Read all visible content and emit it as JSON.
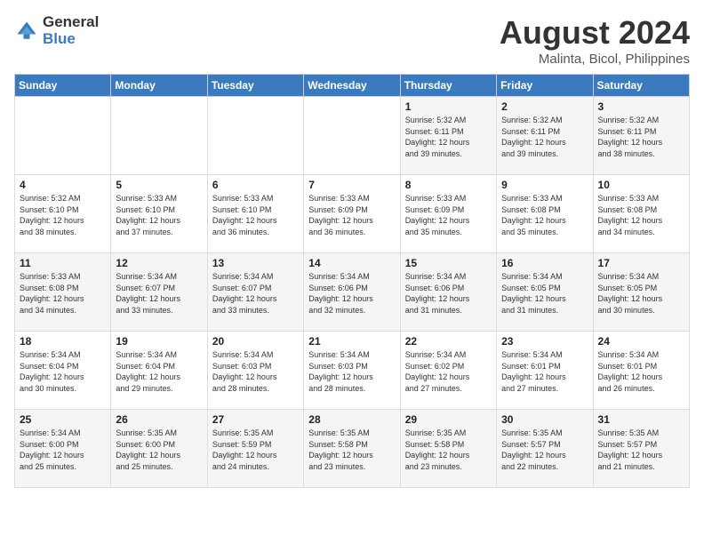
{
  "header": {
    "logo_general": "General",
    "logo_blue": "Blue",
    "month": "August 2024",
    "location": "Malinta, Bicol, Philippines"
  },
  "days_of_week": [
    "Sunday",
    "Monday",
    "Tuesday",
    "Wednesday",
    "Thursday",
    "Friday",
    "Saturday"
  ],
  "weeks": [
    [
      {
        "num": "",
        "detail": ""
      },
      {
        "num": "",
        "detail": ""
      },
      {
        "num": "",
        "detail": ""
      },
      {
        "num": "",
        "detail": ""
      },
      {
        "num": "1",
        "detail": "Sunrise: 5:32 AM\nSunset: 6:11 PM\nDaylight: 12 hours\nand 39 minutes."
      },
      {
        "num": "2",
        "detail": "Sunrise: 5:32 AM\nSunset: 6:11 PM\nDaylight: 12 hours\nand 39 minutes."
      },
      {
        "num": "3",
        "detail": "Sunrise: 5:32 AM\nSunset: 6:11 PM\nDaylight: 12 hours\nand 38 minutes."
      }
    ],
    [
      {
        "num": "4",
        "detail": "Sunrise: 5:32 AM\nSunset: 6:10 PM\nDaylight: 12 hours\nand 38 minutes."
      },
      {
        "num": "5",
        "detail": "Sunrise: 5:33 AM\nSunset: 6:10 PM\nDaylight: 12 hours\nand 37 minutes."
      },
      {
        "num": "6",
        "detail": "Sunrise: 5:33 AM\nSunset: 6:10 PM\nDaylight: 12 hours\nand 36 minutes."
      },
      {
        "num": "7",
        "detail": "Sunrise: 5:33 AM\nSunset: 6:09 PM\nDaylight: 12 hours\nand 36 minutes."
      },
      {
        "num": "8",
        "detail": "Sunrise: 5:33 AM\nSunset: 6:09 PM\nDaylight: 12 hours\nand 35 minutes."
      },
      {
        "num": "9",
        "detail": "Sunrise: 5:33 AM\nSunset: 6:08 PM\nDaylight: 12 hours\nand 35 minutes."
      },
      {
        "num": "10",
        "detail": "Sunrise: 5:33 AM\nSunset: 6:08 PM\nDaylight: 12 hours\nand 34 minutes."
      }
    ],
    [
      {
        "num": "11",
        "detail": "Sunrise: 5:33 AM\nSunset: 6:08 PM\nDaylight: 12 hours\nand 34 minutes."
      },
      {
        "num": "12",
        "detail": "Sunrise: 5:34 AM\nSunset: 6:07 PM\nDaylight: 12 hours\nand 33 minutes."
      },
      {
        "num": "13",
        "detail": "Sunrise: 5:34 AM\nSunset: 6:07 PM\nDaylight: 12 hours\nand 33 minutes."
      },
      {
        "num": "14",
        "detail": "Sunrise: 5:34 AM\nSunset: 6:06 PM\nDaylight: 12 hours\nand 32 minutes."
      },
      {
        "num": "15",
        "detail": "Sunrise: 5:34 AM\nSunset: 6:06 PM\nDaylight: 12 hours\nand 31 minutes."
      },
      {
        "num": "16",
        "detail": "Sunrise: 5:34 AM\nSunset: 6:05 PM\nDaylight: 12 hours\nand 31 minutes."
      },
      {
        "num": "17",
        "detail": "Sunrise: 5:34 AM\nSunset: 6:05 PM\nDaylight: 12 hours\nand 30 minutes."
      }
    ],
    [
      {
        "num": "18",
        "detail": "Sunrise: 5:34 AM\nSunset: 6:04 PM\nDaylight: 12 hours\nand 30 minutes."
      },
      {
        "num": "19",
        "detail": "Sunrise: 5:34 AM\nSunset: 6:04 PM\nDaylight: 12 hours\nand 29 minutes."
      },
      {
        "num": "20",
        "detail": "Sunrise: 5:34 AM\nSunset: 6:03 PM\nDaylight: 12 hours\nand 28 minutes."
      },
      {
        "num": "21",
        "detail": "Sunrise: 5:34 AM\nSunset: 6:03 PM\nDaylight: 12 hours\nand 28 minutes."
      },
      {
        "num": "22",
        "detail": "Sunrise: 5:34 AM\nSunset: 6:02 PM\nDaylight: 12 hours\nand 27 minutes."
      },
      {
        "num": "23",
        "detail": "Sunrise: 5:34 AM\nSunset: 6:01 PM\nDaylight: 12 hours\nand 27 minutes."
      },
      {
        "num": "24",
        "detail": "Sunrise: 5:34 AM\nSunset: 6:01 PM\nDaylight: 12 hours\nand 26 minutes."
      }
    ],
    [
      {
        "num": "25",
        "detail": "Sunrise: 5:34 AM\nSunset: 6:00 PM\nDaylight: 12 hours\nand 25 minutes."
      },
      {
        "num": "26",
        "detail": "Sunrise: 5:35 AM\nSunset: 6:00 PM\nDaylight: 12 hours\nand 25 minutes."
      },
      {
        "num": "27",
        "detail": "Sunrise: 5:35 AM\nSunset: 5:59 PM\nDaylight: 12 hours\nand 24 minutes."
      },
      {
        "num": "28",
        "detail": "Sunrise: 5:35 AM\nSunset: 5:58 PM\nDaylight: 12 hours\nand 23 minutes."
      },
      {
        "num": "29",
        "detail": "Sunrise: 5:35 AM\nSunset: 5:58 PM\nDaylight: 12 hours\nand 23 minutes."
      },
      {
        "num": "30",
        "detail": "Sunrise: 5:35 AM\nSunset: 5:57 PM\nDaylight: 12 hours\nand 22 minutes."
      },
      {
        "num": "31",
        "detail": "Sunrise: 5:35 AM\nSunset: 5:57 PM\nDaylight: 12 hours\nand 21 minutes."
      }
    ]
  ]
}
